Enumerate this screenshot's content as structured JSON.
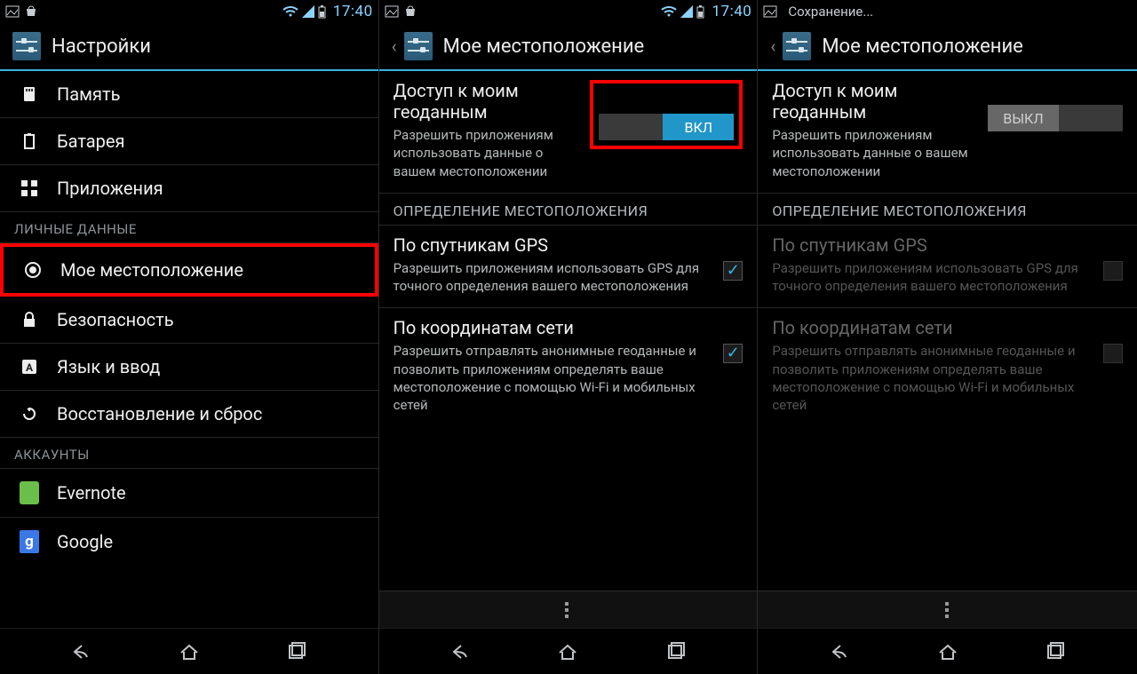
{
  "clock": "17:40",
  "saving_label": "Сохранение...",
  "panel1": {
    "header_title": "Настройки",
    "rows": {
      "memory": "Память",
      "battery": "Батарея",
      "apps": "Приложения"
    },
    "section_personal": "ЛИЧНЫЕ ДАННЫЕ",
    "rows2": {
      "location": "Мое местоположение",
      "security": "Безопасность",
      "language": "Язык и ввод",
      "restore": "Восстановление и сброс"
    },
    "section_accounts": "АККАУНТЫ",
    "accounts": {
      "evernote": "Evernote",
      "google": "Google"
    }
  },
  "panel2": {
    "header_title": "Мое местоположение",
    "geo_title": "Доступ к моим геоданным",
    "geo_desc": "Разрешить приложениям использовать данные о вашем местоположении",
    "toggle_on": "ВКЛ",
    "section_detect": "ОПРЕДЕЛЕНИЕ МЕСТОПОЛОЖЕНИЯ",
    "gps_title": "По спутникам GPS",
    "gps_desc": "Разрешить приложениям использовать GPS для точного определения вашего местоположения",
    "net_title": "По координатам сети",
    "net_desc": "Разрешить отправлять анонимные геоданные и позволить приложениям определять ваше местоположение с помощью Wi-Fi и мобильных сетей"
  },
  "panel3": {
    "header_title": "Мое местоположение",
    "geo_title": "Доступ к моим геоданным",
    "geo_desc": "Разрешить приложениям использовать данные о вашем местоположении",
    "toggle_off": "ВЫКЛ",
    "section_detect": "ОПРЕДЕЛЕНИЕ МЕСТОПОЛОЖЕНИЯ",
    "gps_title": "По спутникам GPS",
    "gps_desc": "Разрешить приложениям использовать GPS для точного определения вашего местоположения",
    "net_title": "По координатам сети",
    "net_desc": "Разрешить отправлять анонимные геоданные и позволить приложениям определять ваше местоположение с помощью Wi-Fi и мобильных сетей"
  }
}
